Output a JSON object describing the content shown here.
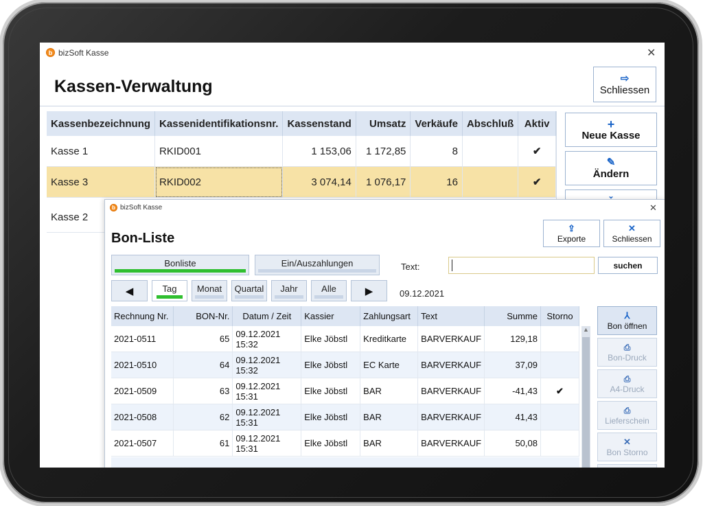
{
  "main_window": {
    "title": "bizSoft Kasse",
    "heading": "Kassen-Verwaltung",
    "close_button": {
      "label": "Schliessen",
      "icon": "exit-icon"
    },
    "side_buttons": [
      {
        "label": "Neue Kasse",
        "icon": "plus-icon"
      },
      {
        "label": "Ändern",
        "icon": "pencil-icon"
      }
    ],
    "table": {
      "columns": [
        "Kassenbezeichnung",
        "Kassenidentifikationsnr.",
        "Kassenstand",
        "Umsatz",
        "Verkäufe",
        "Abschluß",
        "Aktiv"
      ],
      "rows": [
        {
          "name": "Kasse 1",
          "id": "RKID001",
          "stand": "1 153,06",
          "umsatz": "1 172,85",
          "verkaeufe": "8",
          "abschluss": "",
          "aktiv": "✔"
        },
        {
          "name": "Kasse 3",
          "id": "RKID002",
          "stand": "3 074,14",
          "umsatz": "1 076,17",
          "verkaeufe": "16",
          "abschluss": "",
          "aktiv": "✔"
        },
        {
          "name": "Kasse 2"
        }
      ]
    }
  },
  "bon_window": {
    "title": "bizSoft Kasse",
    "heading": "Bon-Liste",
    "export_button": "Exporte",
    "close_button": "Schliessen",
    "tabs": [
      "Bonliste",
      "Ein/Auszahlungen"
    ],
    "search": {
      "label": "Text:",
      "value": "",
      "button": "suchen"
    },
    "period_buttons": [
      "Tag",
      "Monat",
      "Quartal",
      "Jahr",
      "Alle"
    ],
    "date": "09.12.2021",
    "columns": [
      "Rechnung Nr.",
      "BON-Nr.",
      "Datum / Zeit",
      "Kassier",
      "Zahlungsart",
      "Text",
      "Summe",
      "Storno"
    ],
    "rows": [
      {
        "rechnung": "2021-0511",
        "bon": "65",
        "datum": "09.12.2021 15:32",
        "kassier": "Elke Jöbstl",
        "zahlungsart": "Kreditkarte",
        "text": "BARVERKAUF",
        "summe": "129,18",
        "storno": ""
      },
      {
        "rechnung": "2021-0510",
        "bon": "64",
        "datum": "09.12.2021 15:32",
        "kassier": "Elke Jöbstl",
        "zahlungsart": "EC Karte",
        "text": "BARVERKAUF",
        "summe": "37,09",
        "storno": ""
      },
      {
        "rechnung": "2021-0509",
        "bon": "63",
        "datum": "09.12.2021 15:31",
        "kassier": "Elke Jöbstl",
        "zahlungsart": "BAR",
        "text": "BARVERKAUF",
        "summe": "-41,43",
        "storno": "✔"
      },
      {
        "rechnung": "2021-0508",
        "bon": "62",
        "datum": "09.12.2021 15:31",
        "kassier": "Elke Jöbstl",
        "zahlungsart": "BAR",
        "text": "BARVERKAUF",
        "summe": "41,43",
        "storno": ""
      },
      {
        "rechnung": "2021-0507",
        "bon": "61",
        "datum": "09.12.2021 15:31",
        "kassier": "Elke Jöbstl",
        "zahlungsart": "BAR",
        "text": "BARVERKAUF",
        "summe": "50,08",
        "storno": ""
      }
    ],
    "action_buttons": [
      {
        "label": "Bon öffnen",
        "icon": "pdf-icon",
        "enabled": true
      },
      {
        "label": "Bon-Druck",
        "icon": "printer-icon",
        "enabled": false
      },
      {
        "label": "A4-Druck",
        "icon": "printer-icon",
        "enabled": false
      },
      {
        "label": "Lieferschein",
        "icon": "printer-icon",
        "enabled": false
      },
      {
        "label": "Bon Storno",
        "icon": "x-icon",
        "enabled": false
      }
    ]
  },
  "colors": {
    "accent": "#1a64c8",
    "selected_row": "#f7e2a6",
    "header": "#dde6f3",
    "active_tab": "#2fbf2f",
    "check": "#2db52d"
  }
}
